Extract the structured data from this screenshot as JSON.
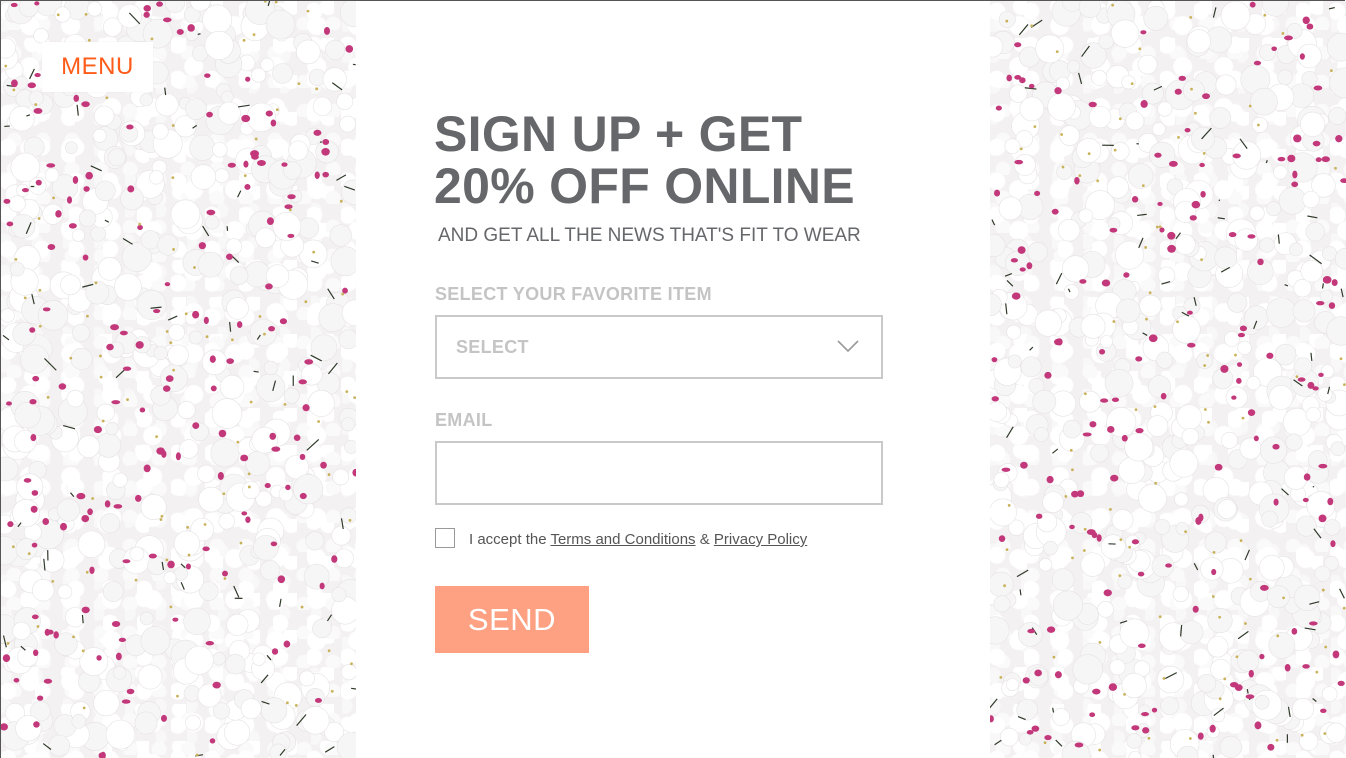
{
  "nav": {
    "menu_label": "MENU"
  },
  "signup": {
    "headline_line1": "SIGN UP + GET",
    "headline_line2": "20% OFF ONLINE",
    "subheadline": "AND GET ALL THE NEWS THAT'S FIT TO WEAR",
    "favorite_label": "SELECT YOUR FAVORITE ITEM",
    "favorite_select_value": "SELECT",
    "email_label": "EMAIL",
    "email_value": "",
    "consent_prefix": "I accept the",
    "terms_link": "Terms and Conditions",
    "consent_joiner": "&",
    "privacy_link": "Privacy Policy",
    "send_label": "SEND"
  },
  "colors": {
    "accent": "#ff5c1a",
    "send_button": "#fea183",
    "headline": "#66676a",
    "label": "#c4c4c4",
    "orchid": "#c2387a"
  },
  "icons": {
    "select_chevron": "chevron-down-icon",
    "background": "orchid-flowers-image"
  }
}
